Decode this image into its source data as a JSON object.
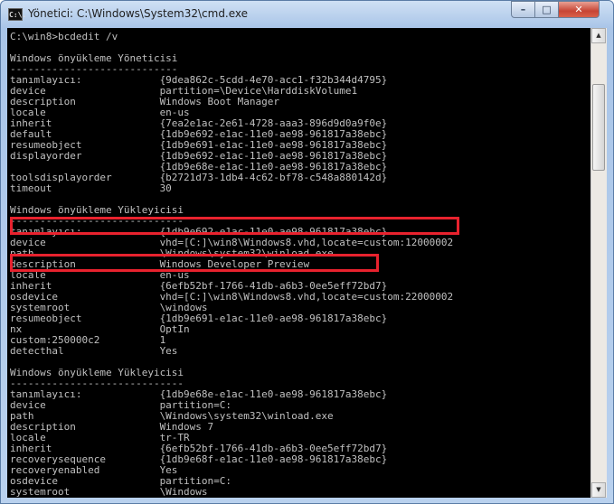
{
  "window": {
    "title": "Yönetici: C:\\Windows\\System32\\cmd.exe",
    "app_icon": "C:\\.",
    "minimize": "–",
    "maximize": "□",
    "close": "✕"
  },
  "scrollbar": {
    "up": "▲",
    "down": "▼"
  },
  "lines": [
    "C:\\win8>bcdedit /v",
    "",
    "Windows önyükleme Yöneticisi",
    "----------------------------",
    "tanımlayıcı:             {9dea862c-5cdd-4e70-acc1-f32b344d4795}",
    "device                   partition=\\Device\\HarddiskVolume1",
    "description              Windows Boot Manager",
    "locale                   en-us",
    "inherit                  {7ea2e1ac-2e61-4728-aaa3-896d9d0a9f0e}",
    "default                  {1db9e692-e1ac-11e0-ae98-961817a38ebc}",
    "resumeobject             {1db9e691-e1ac-11e0-ae98-961817a38ebc}",
    "displayorder             {1db9e692-e1ac-11e0-ae98-961817a38ebc}",
    "                         {1db9e68e-e1ac-11e0-ae98-961817a38ebc}",
    "toolsdisplayorder        {b2721d73-1db4-4c62-bf78-c548a880142d}",
    "timeout                  30",
    "",
    "Windows önyükleme Yükleyicisi",
    "-----------------------------",
    "tanımlayıcı:             {1db9e692-e1ac-11e0-ae98-961817a38ebc}",
    "device                   vhd=[C:]\\win8\\Windows8.vhd,locate=custom:12000002",
    "path                     \\Windows\\system32\\winload.exe",
    "description              Windows Developer Preview",
    "locale                   en-us",
    "inherit                  {6efb52bf-1766-41db-a6b3-0ee5eff72bd7}",
    "osdevice                 vhd=[C:]\\win8\\Windows8.vhd,locate=custom:22000002",
    "systemroot               \\windows",
    "resumeobject             {1db9e691-e1ac-11e0-ae98-961817a38ebc}",
    "nx                       OptIn",
    "custom:250000c2          1",
    "detecthal                Yes",
    "",
    "Windows önyükleme Yükleyicisi",
    "-----------------------------",
    "tanımlayıcı:             {1db9e68e-e1ac-11e0-ae98-961817a38ebc}",
    "device                   partition=C:",
    "path                     \\Windows\\system32\\winload.exe",
    "description              Windows 7",
    "locale                   tr-TR",
    "inherit                  {6efb52bf-1766-41db-a6b3-0ee5eff72bd7}",
    "recoverysequence         {1db9e68f-e1ac-11e0-ae98-961817a38ebc}",
    "recoveryenabled          Yes",
    "osdevice                 partition=C:",
    "systemroot               \\Windows"
  ],
  "colors": {
    "highlight": "#e8222e",
    "console_bg": "#000000",
    "console_text": "#c0c0c0"
  }
}
